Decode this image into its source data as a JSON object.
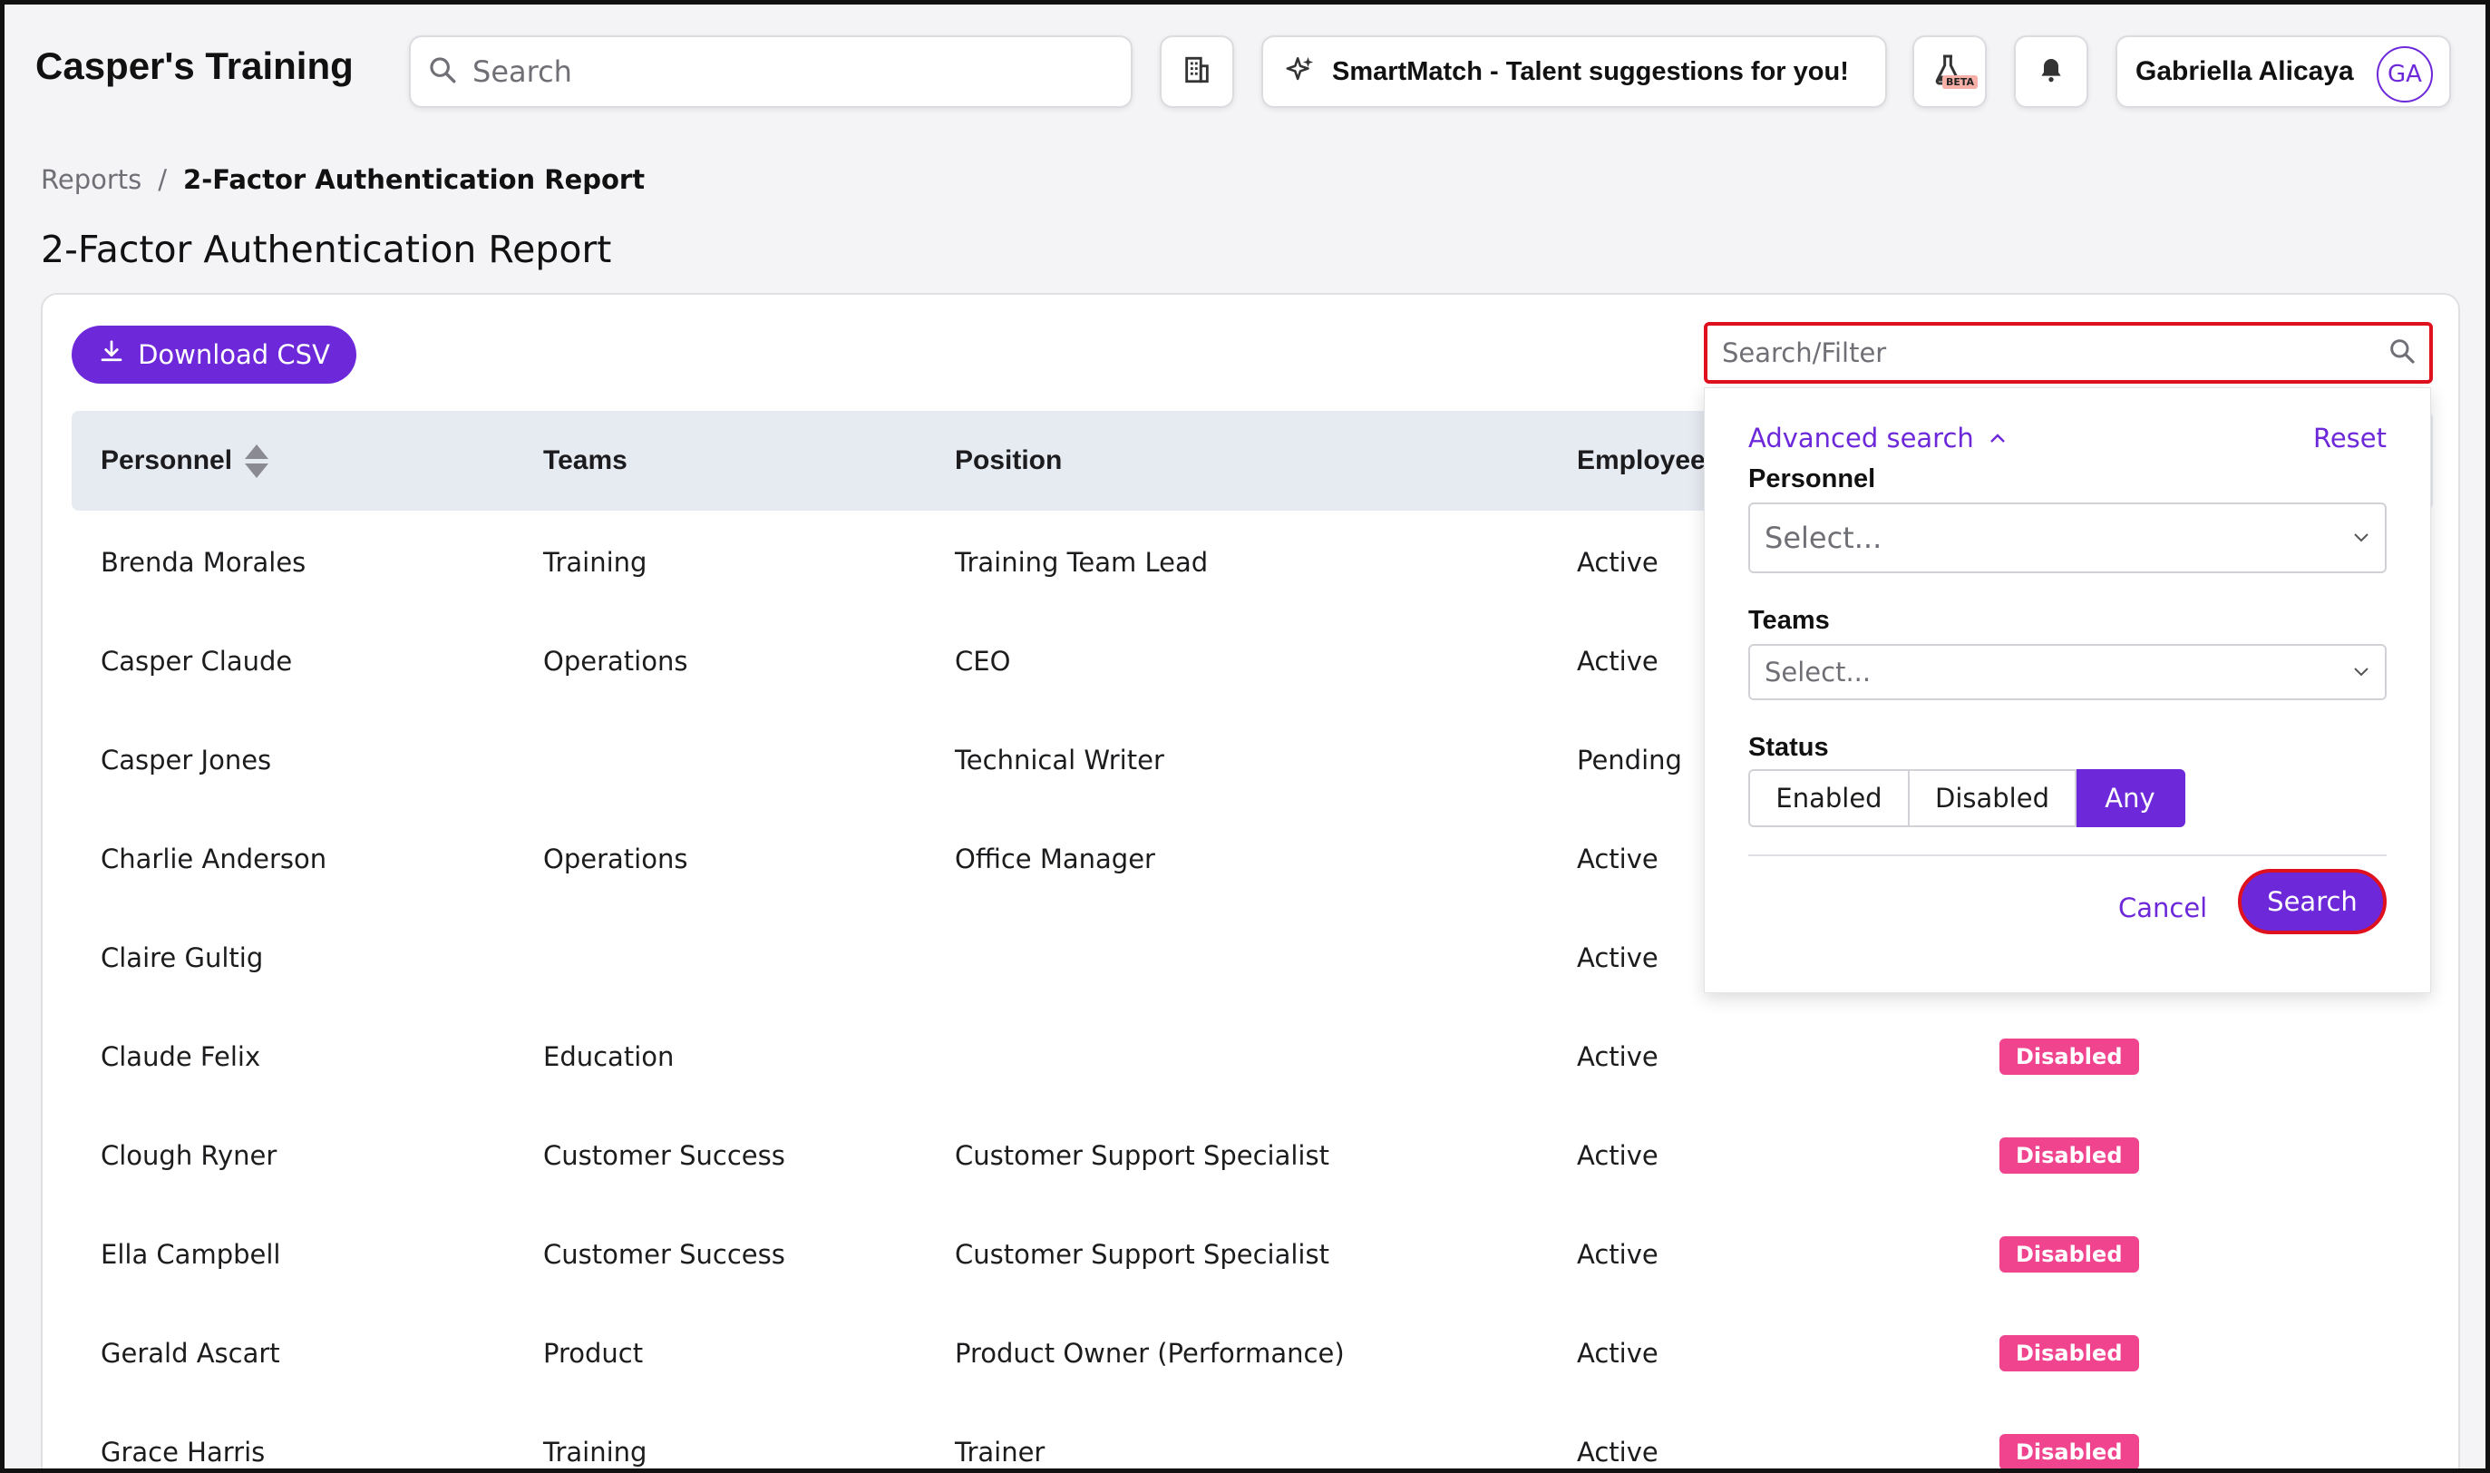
{
  "header": {
    "app_title": "Casper's Training",
    "search_placeholder": "Search",
    "smartmatch_label": "SmartMatch - Talent suggestions for you!",
    "beta_label": "BETA",
    "user_name": "Gabriella Alicaya",
    "user_initials": "GA"
  },
  "breadcrumb": {
    "parent": "Reports",
    "separator": "/",
    "current": "2-Factor Authentication Report"
  },
  "page": {
    "title": "2-Factor Authentication Report",
    "download_label": "Download CSV",
    "filter_placeholder": "Search/Filter"
  },
  "table": {
    "columns": [
      "Personnel",
      "Teams",
      "Position",
      "Employee"
    ],
    "rows": [
      {
        "personnel": "Brenda Morales",
        "team": "Training",
        "position": "Training Team Lead",
        "status": "Active",
        "twofa": ""
      },
      {
        "personnel": "Casper Claude",
        "team": "Operations",
        "position": "CEO",
        "status": "Active",
        "twofa": ""
      },
      {
        "personnel": "Casper Jones",
        "team": "",
        "position": "Technical Writer",
        "status": "Pending",
        "twofa": ""
      },
      {
        "personnel": "Charlie Anderson",
        "team": "Operations",
        "position": "Office Manager",
        "status": "Active",
        "twofa": ""
      },
      {
        "personnel": "Claire Gultig",
        "team": "",
        "position": "",
        "status": "Active",
        "twofa": ""
      },
      {
        "personnel": "Claude Felix",
        "team": "Education",
        "position": "",
        "status": "Active",
        "twofa": "Disabled"
      },
      {
        "personnel": "Clough Ryner",
        "team": "Customer Success",
        "position": "Customer Support Specialist",
        "status": "Active",
        "twofa": "Disabled"
      },
      {
        "personnel": "Ella Campbell",
        "team": "Customer Success",
        "position": "Customer Support Specialist",
        "status": "Active",
        "twofa": "Disabled"
      },
      {
        "personnel": "Gerald Ascart",
        "team": "Product",
        "position": "Product Owner (Performance)",
        "status": "Active",
        "twofa": "Disabled"
      },
      {
        "personnel": "Grace Harris",
        "team": "Training",
        "position": "Trainer",
        "status": "Active",
        "twofa": "Disabled"
      }
    ]
  },
  "advanced": {
    "toggle_label": "Advanced search",
    "reset_label": "Reset",
    "personnel_label": "Personnel",
    "personnel_placeholder": "Select...",
    "teams_label": "Teams",
    "teams_placeholder": "Select...",
    "status_label": "Status",
    "status_options": [
      "Enabled",
      "Disabled",
      "Any"
    ],
    "status_selected": "Any",
    "cancel_label": "Cancel",
    "search_label": "Search"
  },
  "colors": {
    "accent": "#6d28d9",
    "highlight": "#e0111f",
    "badge_disabled": "#f0448f"
  }
}
